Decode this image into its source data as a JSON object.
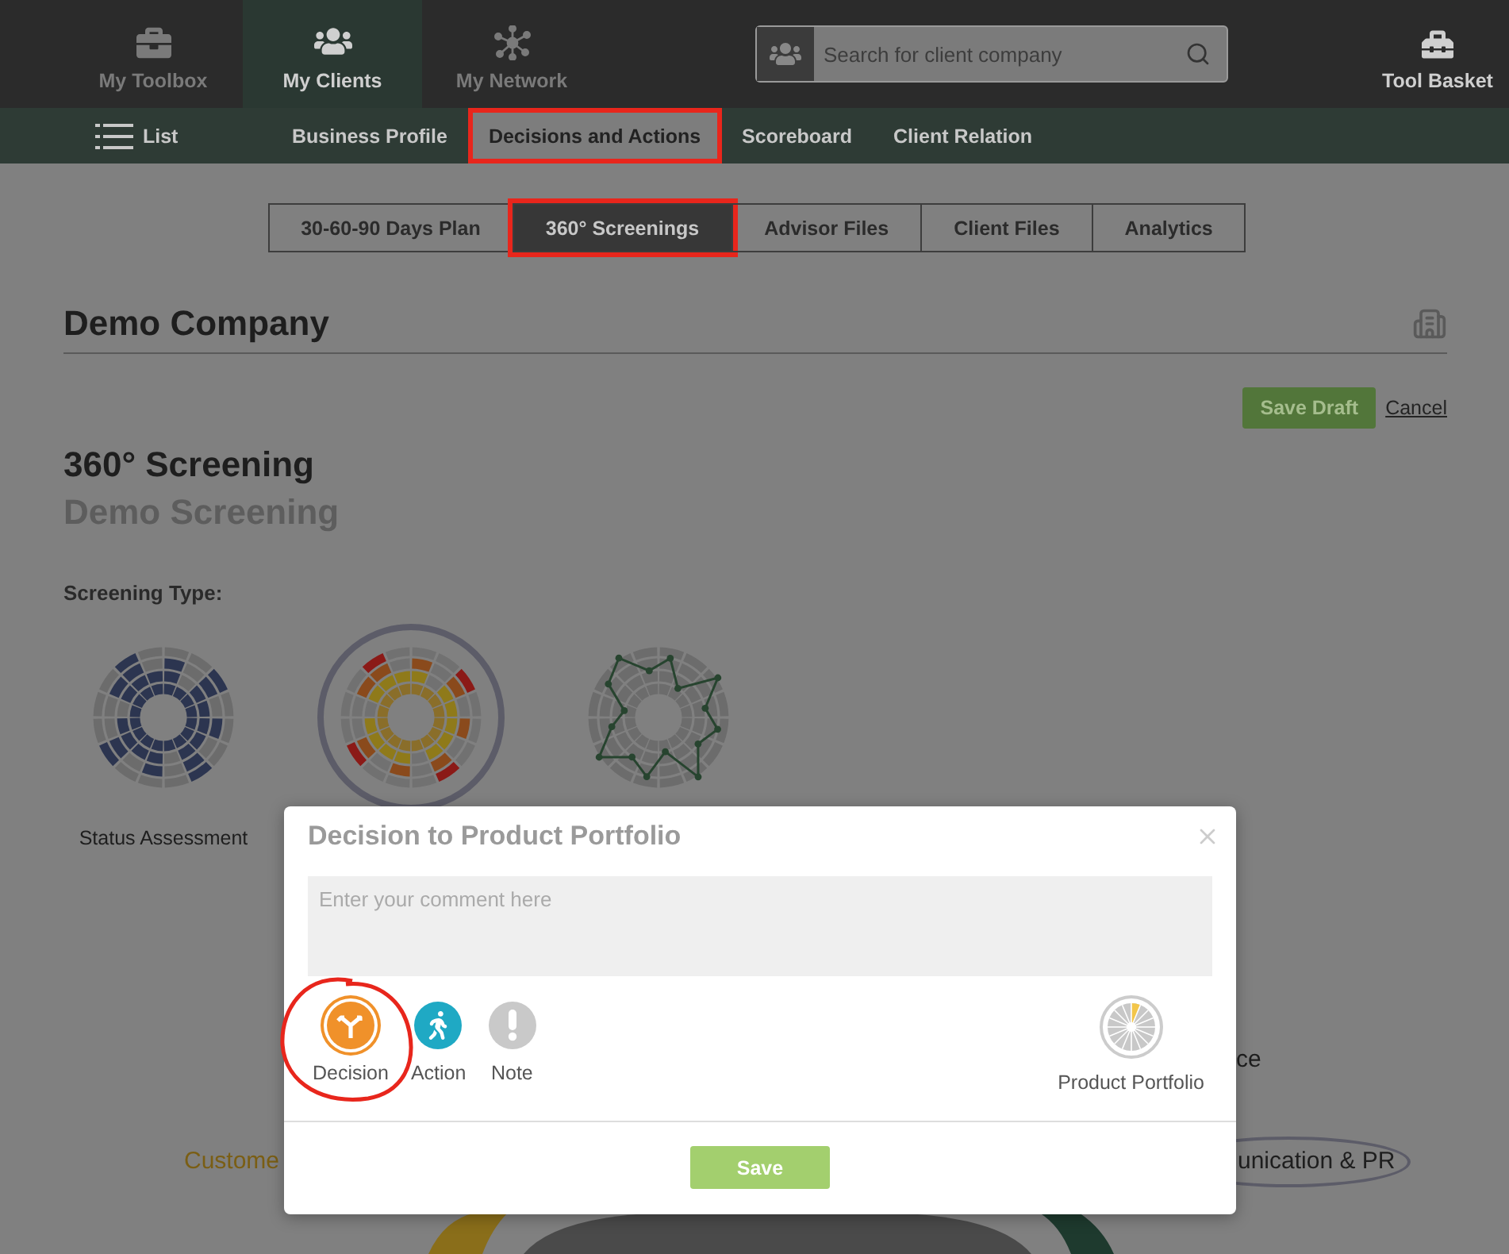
{
  "top_nav": {
    "items": [
      {
        "kind": "toolbox",
        "label": "My Toolbox",
        "selected": false
      },
      {
        "kind": "clients",
        "label": "My Clients",
        "selected": true
      },
      {
        "kind": "network",
        "label": "My Network",
        "selected": false
      }
    ],
    "search": {
      "placeholder": "Search for client company"
    },
    "tool_basket": {
      "label": "Tool Basket"
    }
  },
  "sub_nav": {
    "list_label": "List",
    "items": [
      {
        "label": "Business Profile",
        "selected": false,
        "annotated": false
      },
      {
        "label": "Decisions and Actions",
        "selected": true,
        "annotated": true
      },
      {
        "label": "Scoreboard",
        "selected": false,
        "annotated": false
      },
      {
        "label": "Client Relation",
        "selected": false,
        "annotated": false
      }
    ]
  },
  "tabs": [
    {
      "label": "30-60-90 Days Plan",
      "selected": false,
      "annotated": false
    },
    {
      "label": "360° Screenings",
      "selected": true,
      "annotated": true
    },
    {
      "label": "Advisor Files",
      "selected": false,
      "annotated": false
    },
    {
      "label": "Client Files",
      "selected": false,
      "annotated": false
    },
    {
      "label": "Analytics",
      "selected": false,
      "annotated": false
    }
  ],
  "company": {
    "name": "Demo Company"
  },
  "actions": {
    "save_draft": "Save Draft",
    "cancel": "Cancel"
  },
  "screening": {
    "title": "360° Screening",
    "subtitle": "Demo Screening"
  },
  "screening_type": {
    "label": "Screening Type:",
    "types": [
      {
        "kind": "bars",
        "label": "Status Assessment",
        "selected": false
      },
      {
        "kind": "heat",
        "selected": true
      },
      {
        "kind": "line",
        "selected": false
      }
    ]
  },
  "wheel_labels": {
    "left": "Custome",
    "right_top": "ce",
    "right_bottom": "unication & PR"
  },
  "modal": {
    "title": "Decision to Product Portfolio",
    "comment_placeholder": "Enter your comment here",
    "types": [
      {
        "kind": "decision",
        "label": "Decision",
        "selected": true,
        "annotated": true
      },
      {
        "kind": "action",
        "label": "Action",
        "selected": false,
        "annotated": false
      },
      {
        "kind": "note",
        "label": "Note",
        "selected": false,
        "annotated": false
      }
    ],
    "target": {
      "label": "Product Portfolio"
    },
    "save": "Save"
  }
}
